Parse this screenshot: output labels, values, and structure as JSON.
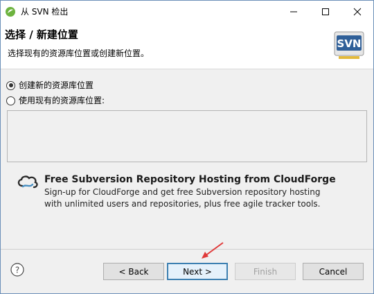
{
  "window": {
    "title": "从 SVN 检出",
    "app_icon": "eclipse-spring-icon",
    "controls": [
      "minimize-icon",
      "maximize-icon",
      "close-icon"
    ]
  },
  "header": {
    "title": "选择 / 新建位置",
    "description": "选择现有的资源库位置或创建新位置。",
    "logo_text": "SVN"
  },
  "options": {
    "create_new": {
      "label": "创建新的资源库位置",
      "checked": true
    },
    "use_existing": {
      "label": "使用现有的资源库位置:",
      "checked": false
    }
  },
  "promo": {
    "icon": "cloudforge-icon",
    "title": "Free Subversion Repository Hosting from CloudForge",
    "line1": "Sign-up for CloudForge and get free Subversion repository hosting",
    "line2": "with unlimited users and repositories, plus free agile tracker tools."
  },
  "footer": {
    "help_icon": "help-icon",
    "back_label": "< Back",
    "next_label": "Next >",
    "finish_label": "Finish",
    "cancel_label": "Cancel"
  },
  "colors": {
    "accent": "#3c7fb1",
    "arrow": "#e03a3a",
    "svn_logo_blue": "#2f5f98",
    "spring_green": "#6db33f"
  }
}
